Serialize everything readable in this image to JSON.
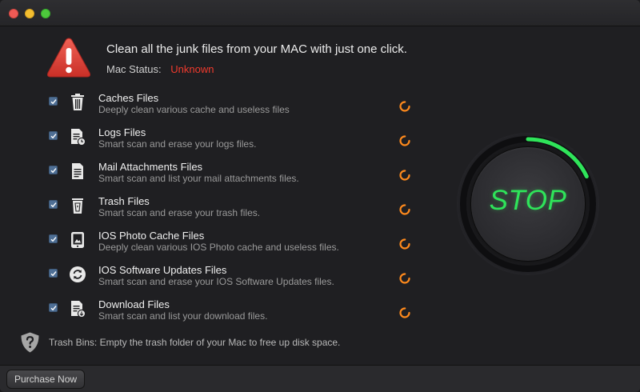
{
  "app": {
    "headline": "Clean all the junk files from your MAC with just one click.",
    "status_label": "Mac Status:",
    "status_value": "Unknown",
    "status_color": "#f03a2d"
  },
  "items": [
    {
      "title": "Caches Files",
      "desc": "Deeply clean various cache and useless files",
      "icon": "trash-bin-icon",
      "checked": true
    },
    {
      "title": "Logs Files",
      "desc": "Smart scan and erase your logs files.",
      "icon": "log-file-icon",
      "checked": true
    },
    {
      "title": "Mail Attachments Files",
      "desc": "Smart scan and list your mail attachments files.",
      "icon": "document-icon",
      "checked": true
    },
    {
      "title": "Trash Files",
      "desc": "Smart scan and erase your trash files.",
      "icon": "trash-can-icon",
      "checked": true
    },
    {
      "title": "IOS Photo Cache Files",
      "desc": "Deeply clean various IOS Photo cache and useless files.",
      "icon": "tablet-icon",
      "checked": true
    },
    {
      "title": "IOS Software Updates Files",
      "desc": "Smart scan and erase your IOS Software Updates files.",
      "icon": "refresh-icon",
      "checked": true
    },
    {
      "title": "Download Files",
      "desc": "Smart scan and list your download files.",
      "icon": "download-file-icon",
      "checked": true
    }
  ],
  "tip": {
    "text": "Trash Bins: Empty the trash folder of your Mac to free up disk space.",
    "icon": "shield-question-icon"
  },
  "footer": {
    "purchase_label": "Purchase Now"
  },
  "scan": {
    "button_label": "STOP",
    "progress": 0.18,
    "accent": "#2fe45a",
    "spinner_color": "#ff8a1c"
  }
}
